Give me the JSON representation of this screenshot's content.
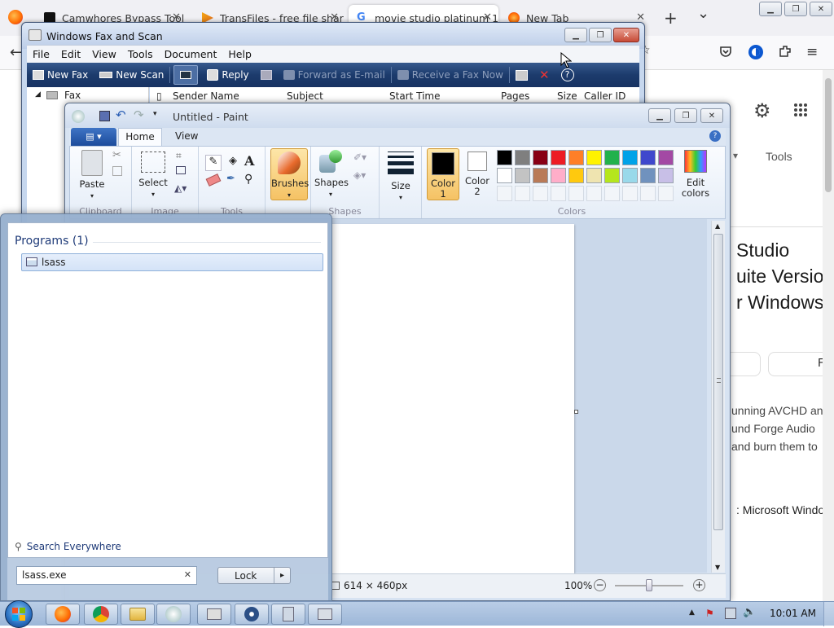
{
  "firefox": {
    "tabs": [
      {
        "label": "Camwhores Bypass Tool",
        "active": false
      },
      {
        "label": "TransFiles - free file shar",
        "active": false
      },
      {
        "label": "movie studio platinum 1",
        "active": true
      },
      {
        "label": "New Tab",
        "active": false
      }
    ],
    "new_tab_symbol": "+",
    "tab_list_symbol": "⌄"
  },
  "webpage": {
    "tools_label": "Tools",
    "heading": [
      "Studio",
      "uite Version",
      "r Windows"
    ],
    "button_partial": "F",
    "body_lines": [
      "unning AVCHD an",
      "und Forge Audio",
      "and burn them to"
    ],
    "os_line": ": Microsoft Windo"
  },
  "fax": {
    "title": "Windows Fax and Scan",
    "menu": [
      "File",
      "Edit",
      "View",
      "Tools",
      "Document",
      "Help"
    ],
    "toolbar": {
      "new_fax": "New Fax",
      "new_scan": "New Scan",
      "reply": "Reply",
      "forward": "Forward as E-mail",
      "receive": "Receive a Fax Now"
    },
    "tree_root": "Fax",
    "columns": [
      "Sender Name",
      "Subject",
      "Start Time",
      "Pages",
      "Size",
      "Caller ID"
    ]
  },
  "paint": {
    "title": "Untitled - Paint",
    "tabs": {
      "home": "Home",
      "view": "View"
    },
    "clipboard": {
      "paste": "Paste",
      "group": "Clipboard"
    },
    "image": {
      "select": "Select",
      "group": "Image"
    },
    "tools_group": "Tools",
    "brushes": "Brushes",
    "shapes": {
      "label": "Shapes",
      "group": "Shapes"
    },
    "size": "Size",
    "color1": [
      "Color",
      "1"
    ],
    "color2": [
      "Color",
      "2"
    ],
    "edit_colors": [
      "Edit",
      "colors"
    ],
    "colors_group": "Colors",
    "palette_row1": [
      "#000000",
      "#7f7f7f",
      "#880015",
      "#ed1c24",
      "#ff7f27",
      "#fff200",
      "#22b14c",
      "#00a2e8",
      "#3f48cc",
      "#a349a4"
    ],
    "palette_row2": [
      "#ffffff",
      "#c3c3c3",
      "#b97a57",
      "#ffaec9",
      "#ffc90e",
      "#efe4b0",
      "#b5e61d",
      "#99d9ea",
      "#7092be",
      "#c8bfe7"
    ],
    "status": {
      "dims": "614 × 460px",
      "zoom": "100%"
    }
  },
  "start_menu": {
    "programs_header": "Programs (1)",
    "result": "lsass",
    "search_everywhere": "Search Everywhere",
    "search_value": "lsass.exe",
    "lock_label": "Lock",
    "arrow": "▸"
  },
  "taskbar": {
    "clock": "10:01 AM"
  }
}
